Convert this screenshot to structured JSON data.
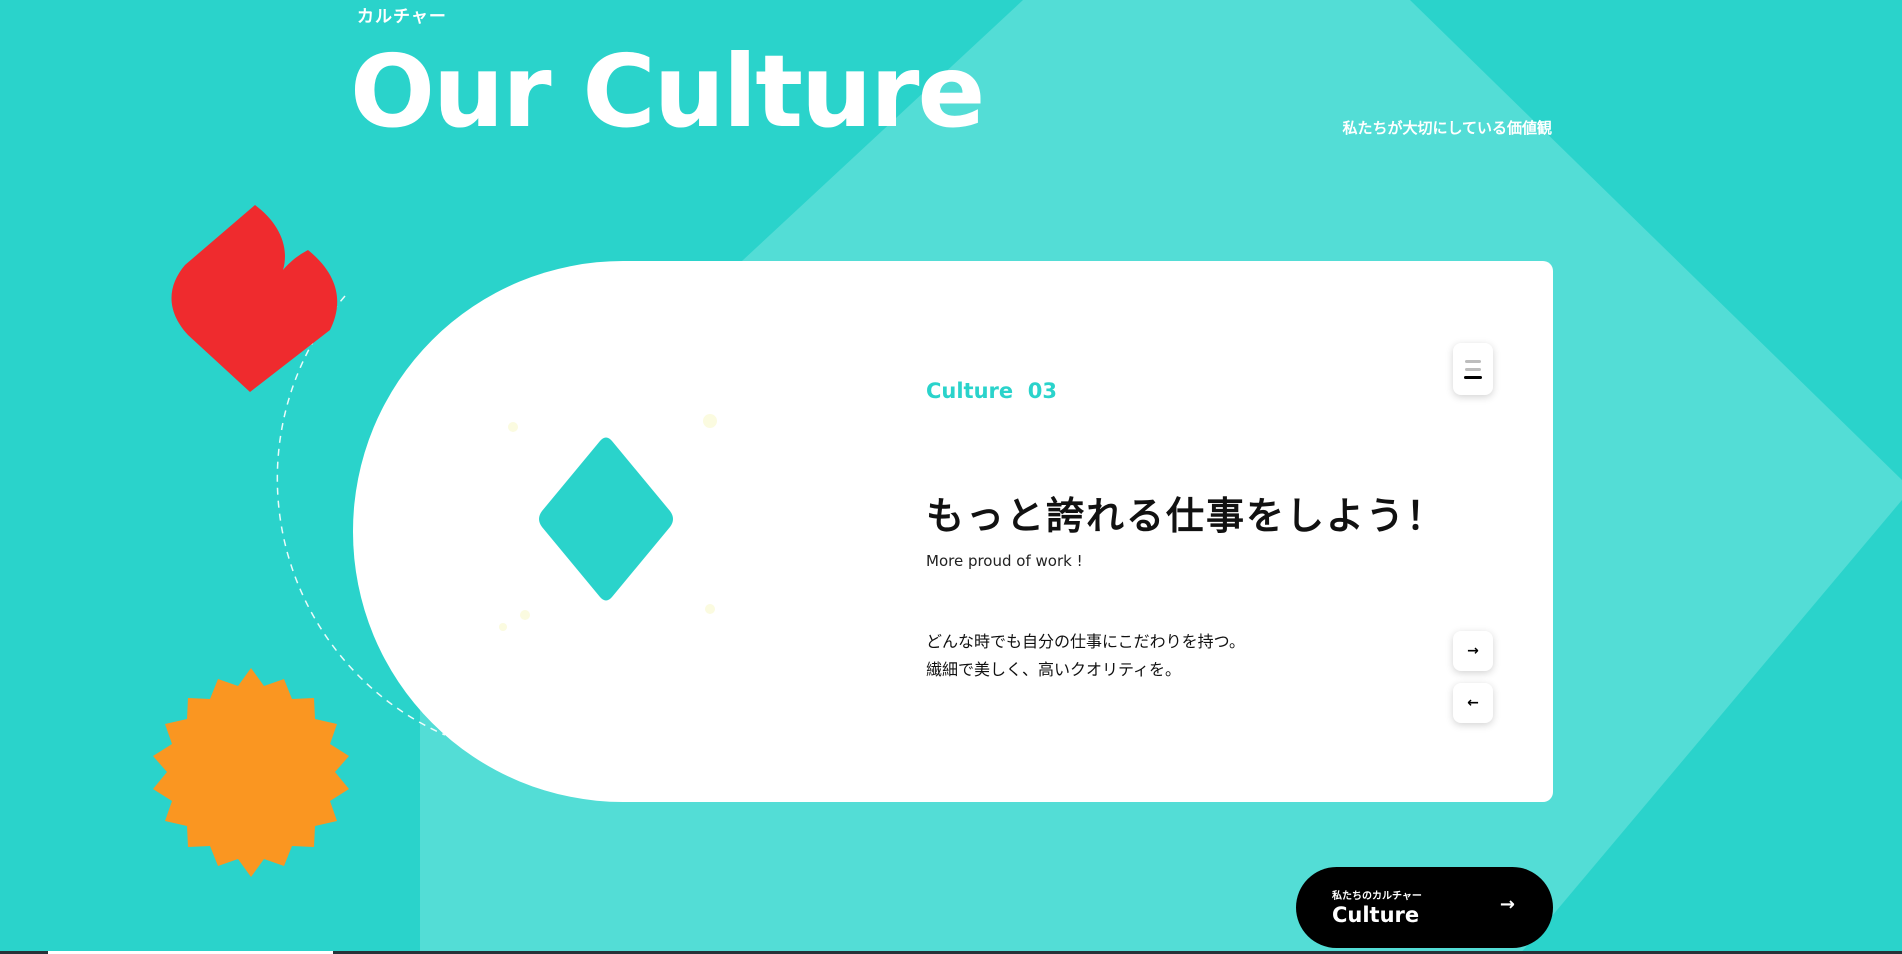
{
  "header": {
    "eyebrow": "カルチャー",
    "title": "Our Culture",
    "subtitle": "私たちが大切にしている価値観"
  },
  "card": {
    "label": "Culture",
    "number": "03",
    "heading": "もっと誇れる仕事をしよう！",
    "heading_en": "More proud of work !",
    "body_lines": [
      "どんな時でも自分の仕事にこだわりを持つ。",
      "繊細で美しく、高いクオリティを。"
    ],
    "controls": {
      "menu_icon": "hamburger-menu-icon",
      "next_icon": "arrow-right-icon",
      "next_glyph": "→",
      "prev_icon": "arrow-left-icon",
      "prev_glyph": "←"
    }
  },
  "cta": {
    "sub": "私たちのカルチャー",
    "label": "Culture",
    "arrow": "→"
  },
  "decorations": {
    "heart_shape": "red-heart-shape",
    "sun_shape": "orange-starburst-shape",
    "diamond_shape": "teal-diamond-shape"
  },
  "colors": {
    "background": "#2ad3cb",
    "background_light": "#53ddd6",
    "accent": "#2ad3cb",
    "red": "#ef2b2e",
    "orange": "#fa9621",
    "card": "#ffffff",
    "cta": "#000000"
  },
  "progress": {
    "fraction": 0.15
  }
}
